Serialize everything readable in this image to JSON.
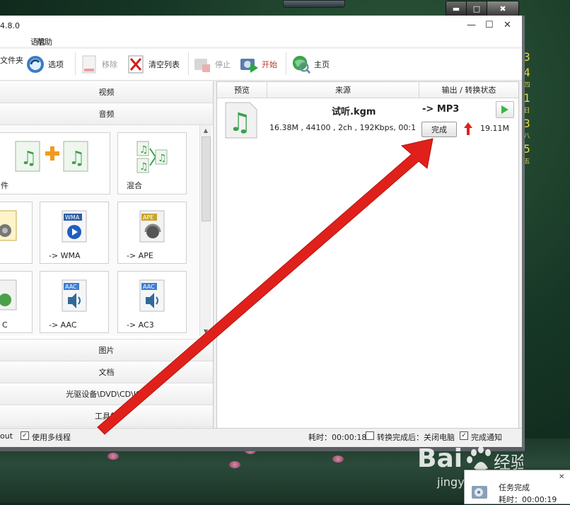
{
  "app": {
    "version": "4.8.0",
    "menu": [
      "语言",
      "帮助"
    ]
  },
  "toolbar": {
    "add_folder": "文件夹",
    "options": "选项",
    "remove": "移除",
    "clear_list": "清空列表",
    "stop": "停止",
    "start": "开始",
    "home": "主页"
  },
  "categories": {
    "video": "视频",
    "audio": "音频",
    "image": "图片",
    "document": "文档",
    "optical": "光驱设备\\DVD\\CD\\ISO",
    "tools": "工具集"
  },
  "audio_tiles": [
    {
      "label": "件",
      "icon": "merge-icon"
    },
    {
      "label": "混合",
      "icon": "mix-icon"
    },
    {
      "label": "",
      "icon": "audio-icon"
    },
    {
      "label": "-> WMA",
      "icon": "wma-icon"
    },
    {
      "label": "-> APE",
      "icon": "ape-icon"
    },
    {
      "label": "C",
      "icon": "aac-icon"
    },
    {
      "label": "-> AAC",
      "icon": "aac-icon"
    },
    {
      "label": "-> AC3",
      "icon": "ac3-icon"
    }
  ],
  "task_list": {
    "headers": [
      "预览",
      "来源",
      "输出 / 转换状态"
    ],
    "item": {
      "filename": "试听.kgm",
      "info": "16.38M , 44100 , 2ch , 192Kbps, 00:1",
      "target": "-> MP3",
      "status_button": "完成",
      "output_size": "19.11M"
    }
  },
  "status_bar": {
    "left_text": "out",
    "multithread_label": "使用多线程",
    "multithread_checked": true,
    "elapsed": "耗时：00:00:18",
    "after_done_label": "转换完成后：关闭电脑",
    "after_done_checked": false,
    "notify_label": "完成通知",
    "notify_checked": true
  },
  "notification": {
    "title": "任务完成",
    "elapsed": "耗时：00:00:19"
  },
  "desktop": {
    "clock_chars": [
      "3",
      "4",
      "四",
      "1",
      "日",
      "3",
      "八",
      "5",
      "五"
    ]
  },
  "watermark": {
    "logo": "Baiↄ经验",
    "sub": "jingyan.baidu.com"
  },
  "colors": {
    "start_label": "#c0392b",
    "arrow": "#e0201b",
    "clock": "#e6d64a"
  }
}
